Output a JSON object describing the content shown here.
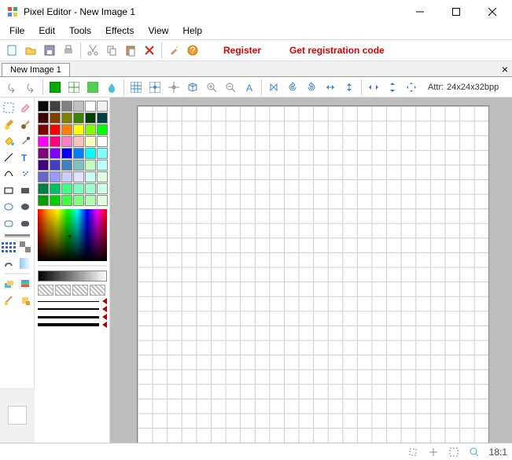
{
  "title": "Pixel Editor - New Image 1",
  "menubar": [
    "File",
    "Edit",
    "Tools",
    "Effects",
    "View",
    "Help"
  ],
  "toolbar_links": {
    "register": "Register",
    "getcode": "Get registration code"
  },
  "tab": "New Image 1",
  "attr_label": "Attr:",
  "attr_value": "24x24x32bpp",
  "status": {
    "zoom": "18:1"
  },
  "palette": [
    "#000000",
    "#404040",
    "#808080",
    "#c0c0c0",
    "#ffffff",
    "#f0f0f0",
    "#400000",
    "#804000",
    "#808000",
    "#408000",
    "#004000",
    "#004040",
    "#800000",
    "#ff0000",
    "#ff8000",
    "#ffff00",
    "#80ff00",
    "#00ff00",
    "#ff00ff",
    "#ff0080",
    "#ff80c0",
    "#ffc0c0",
    "#ffffc0",
    "#ffffff",
    "#800080",
    "#8000ff",
    "#0000ff",
    "#0080ff",
    "#00ffff",
    "#80ffff",
    "#400080",
    "#4040c0",
    "#4080c0",
    "#80c0c0",
    "#c0ffc0",
    "#c0ffff",
    "#6666cc",
    "#9999ff",
    "#ccccff",
    "#e0e0ff",
    "#ccfff0",
    "#e0ffe0",
    "#008040",
    "#00c060",
    "#40ff80",
    "#80ffc0",
    "#a0ffd0",
    "#d0ffe8",
    "#00a000",
    "#00d000",
    "#40ff40",
    "#80ff80",
    "#b0ffb0",
    "#e0ffe0"
  ]
}
